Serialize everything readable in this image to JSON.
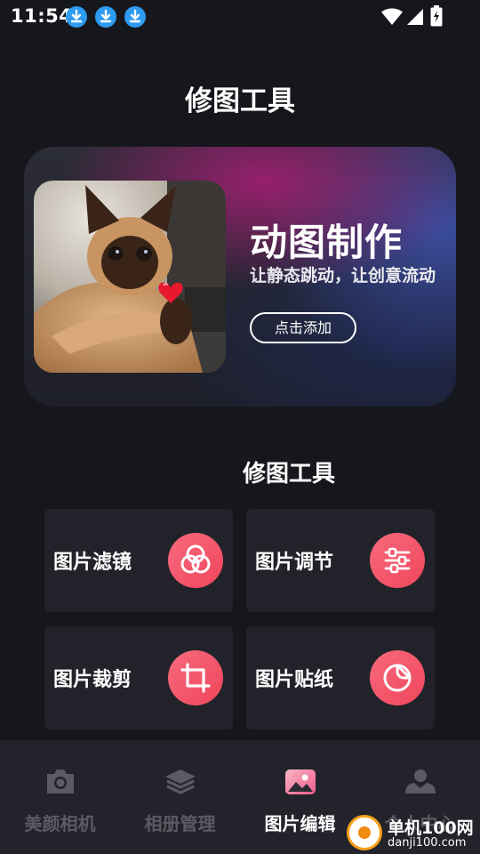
{
  "status_bar": {
    "time": "11:54",
    "icons": [
      "download-icon",
      "download-icon",
      "download-icon",
      "wifi-icon",
      "signal-icon",
      "battery-charging-icon"
    ]
  },
  "page_title": "修图工具",
  "banner": {
    "title": "动图制作",
    "subtitle": "让静态跳动，让创意流动",
    "button_label": "点击添加"
  },
  "section_title": "修图工具",
  "tools": [
    {
      "label": "图片滤镜",
      "icon": "filter-icon"
    },
    {
      "label": "图片调节",
      "icon": "sliders-icon"
    },
    {
      "label": "图片裁剪",
      "icon": "crop-icon"
    },
    {
      "label": "图片贴纸",
      "icon": "sticker-icon"
    }
  ],
  "bottom_nav": [
    {
      "label": "美颜相机",
      "icon": "camera-icon",
      "active": false
    },
    {
      "label": "相册管理",
      "icon": "layers-icon",
      "active": false
    },
    {
      "label": "图片编辑",
      "icon": "image-icon",
      "active": true
    },
    {
      "label": "个人中心",
      "icon": "user-icon",
      "active": false
    }
  ],
  "watermark": {
    "line1": "单机100网",
    "line2": "danji100.com"
  },
  "colors": {
    "background": "#16171c",
    "card": "#22232a",
    "accent_gradient_start": "#f76a7e",
    "accent_gradient_end": "#f0465b",
    "download_badge": "#2d9cf0",
    "nav_inactive": "#5a5b63",
    "nav_active": "#ffffff"
  }
}
